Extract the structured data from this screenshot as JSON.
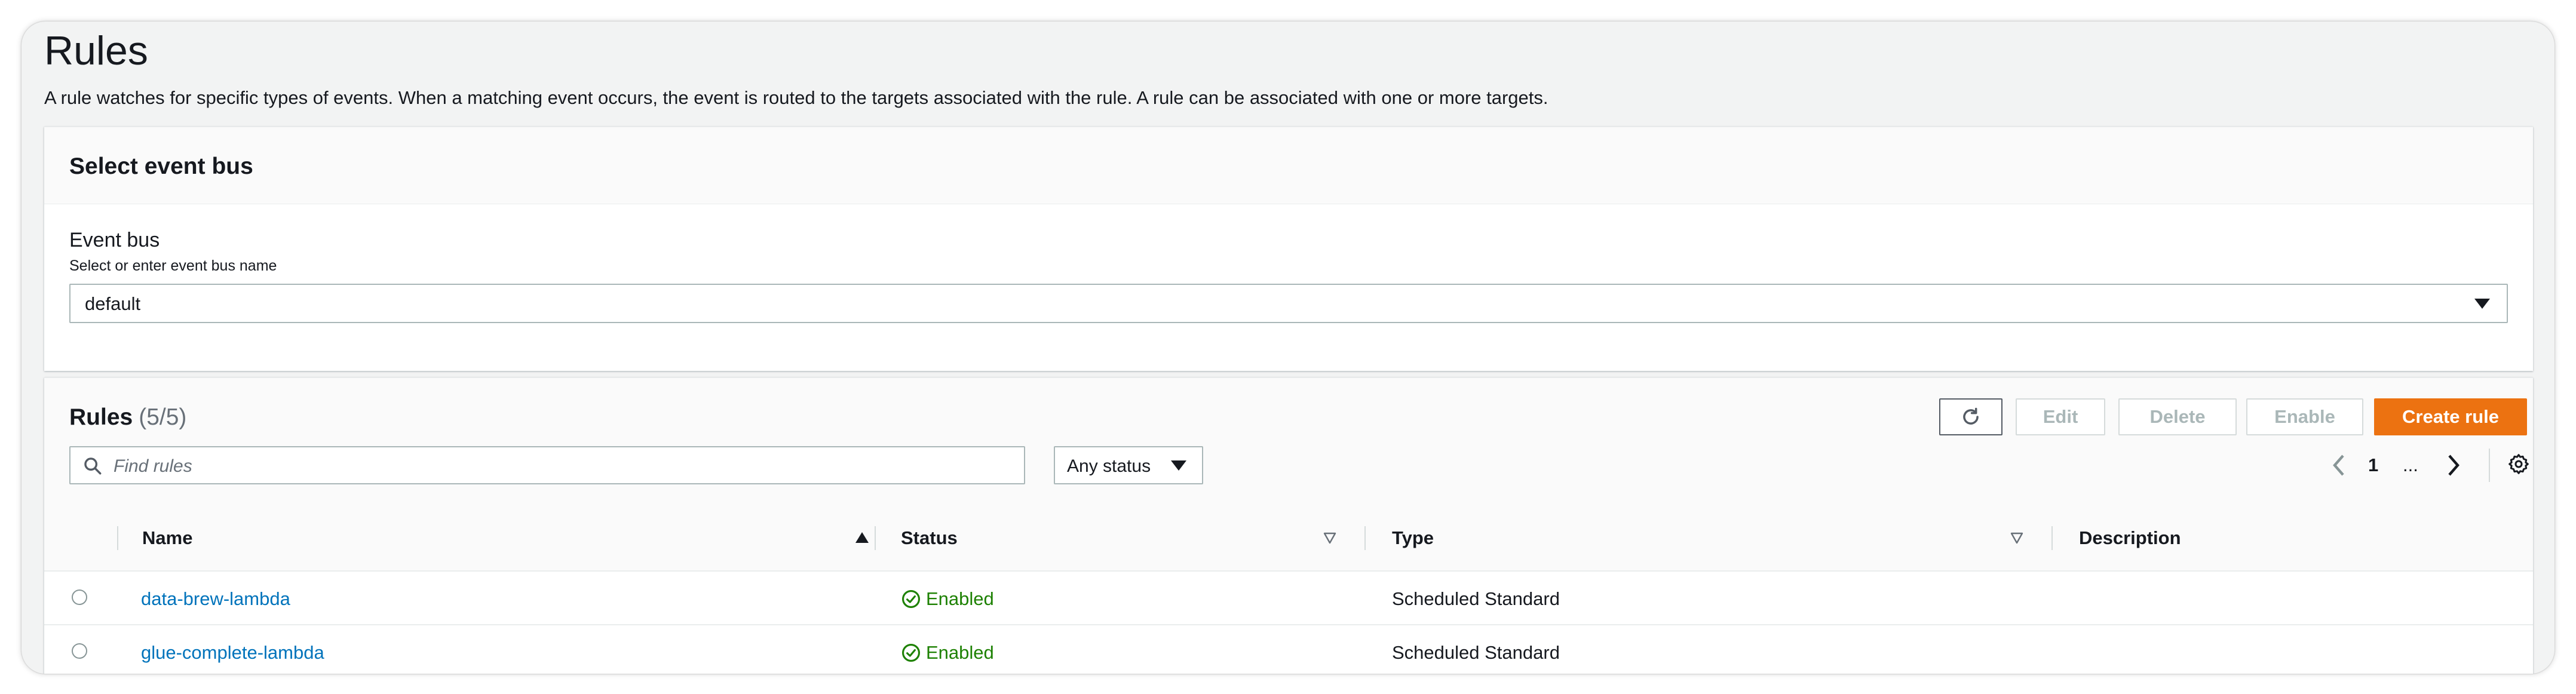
{
  "page": {
    "title": "Rules",
    "description": "A rule watches for specific types of events. When a matching event occurs, the event is routed to the targets associated with the rule. A rule can be associated with one or more targets."
  },
  "event_bus_panel": {
    "title": "Select event bus",
    "field_label": "Event bus",
    "field_hint": "Select or enter event bus name",
    "selected_value": "default"
  },
  "rules_panel": {
    "title": "Rules",
    "count": "(5/5)",
    "buttons": {
      "edit": "Edit",
      "delete": "Delete",
      "enable": "Enable",
      "create": "Create rule"
    },
    "search_placeholder": "Find rules",
    "status_filter": "Any status",
    "pagination": {
      "current_page": "1",
      "ellipsis": "..."
    },
    "columns": [
      "Name",
      "Status",
      "Type",
      "Description"
    ],
    "rows": [
      {
        "name": "data-brew-lambda",
        "status": "Enabled",
        "type": "Scheduled Standard",
        "description": ""
      },
      {
        "name": "glue-complete-lambda",
        "status": "Enabled",
        "type": "Scheduled Standard",
        "description": ""
      }
    ]
  },
  "colors": {
    "accent_orange": "#ec7211",
    "link_blue": "#0073bb",
    "success_green": "#1d8102"
  },
  "icons": [
    "refresh-icon",
    "search-icon",
    "chevron-down-icon",
    "chevron-left-icon",
    "chevron-right-icon",
    "gear-icon",
    "sort-ascending-icon",
    "sort-descending-icon",
    "check-circle-icon"
  ]
}
